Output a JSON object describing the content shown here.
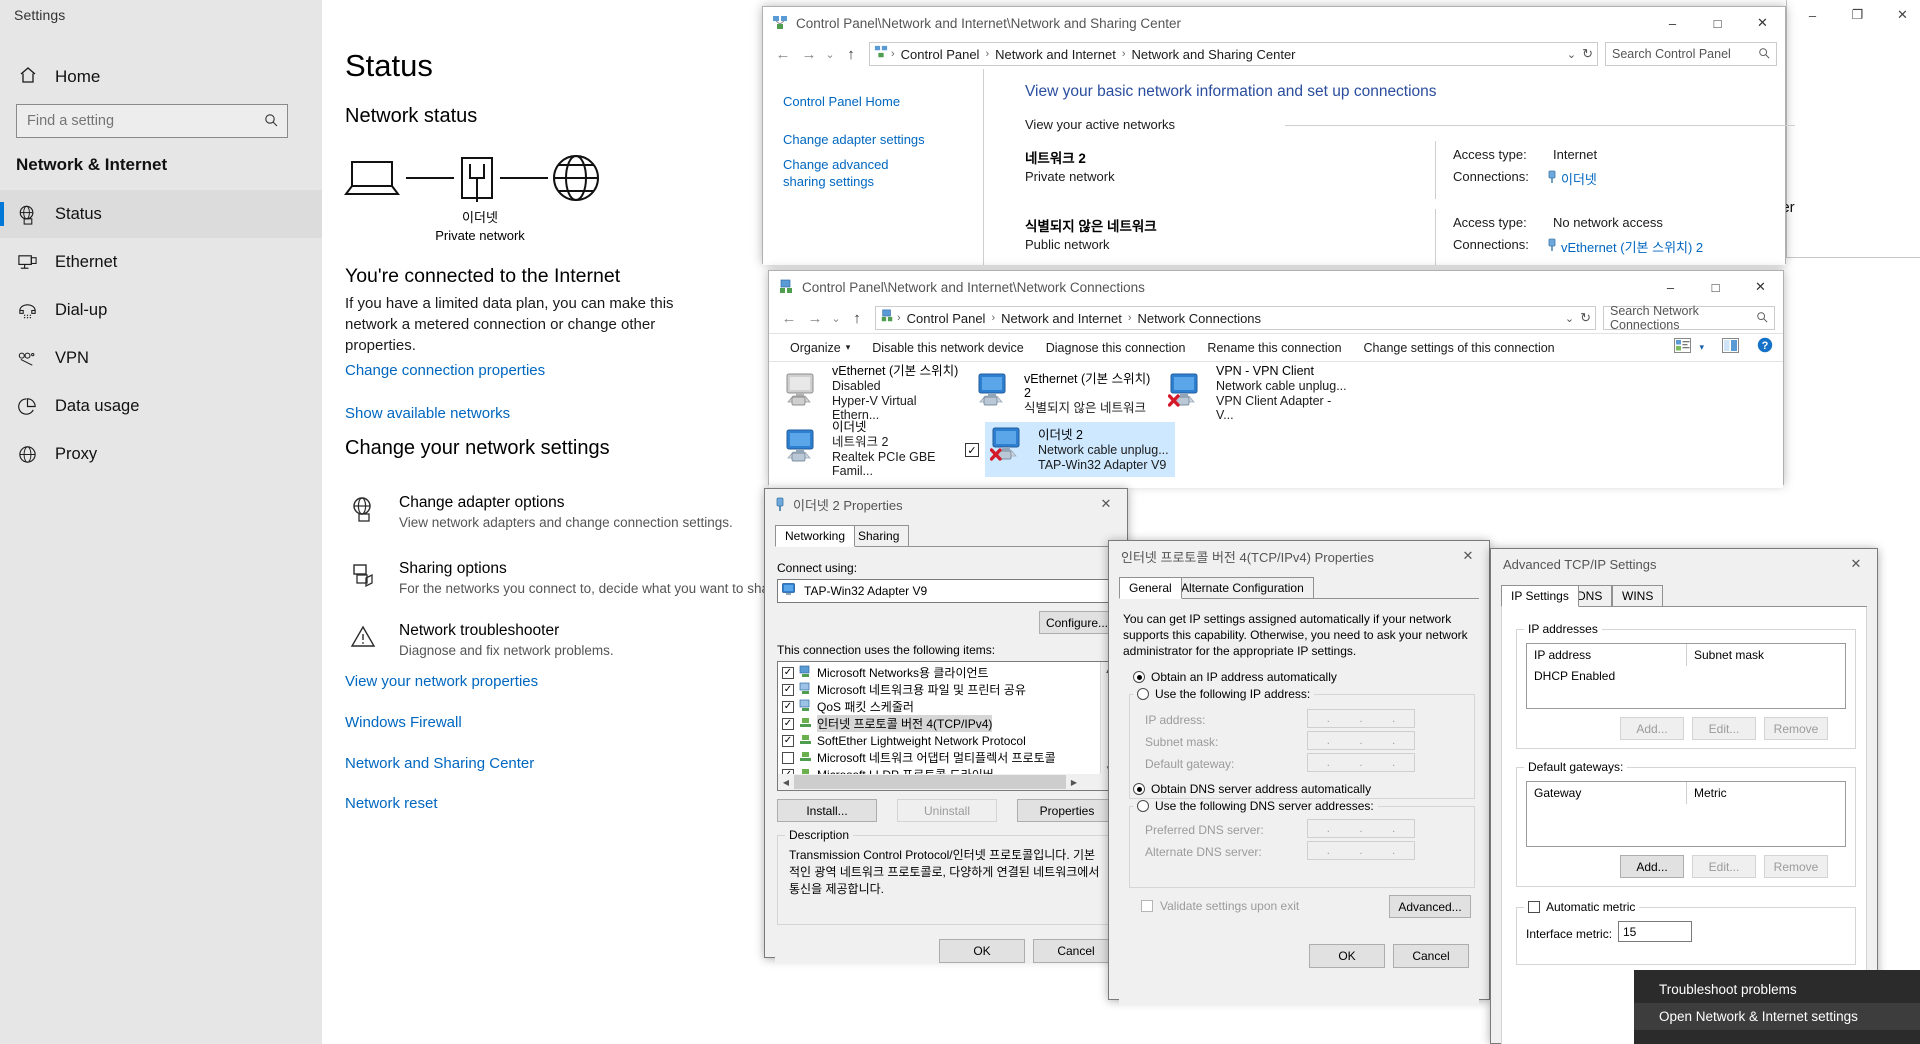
{
  "settings": {
    "window_title": "Settings",
    "home_label": "Home",
    "search": {
      "placeholder": "Find a setting",
      "value": "",
      "icon": "search-icon"
    },
    "category": "Network & Internet",
    "nav_items": [
      {
        "label": "Status",
        "icon": "globe-monitor-icon",
        "selected": true
      },
      {
        "label": "Ethernet",
        "icon": "ethernet-icon",
        "selected": false
      },
      {
        "label": "Dial-up",
        "icon": "dialup-icon",
        "selected": false
      },
      {
        "label": "VPN",
        "icon": "vpn-icon",
        "selected": false
      },
      {
        "label": "Data usage",
        "icon": "pie-chart-icon",
        "selected": false
      },
      {
        "label": "Proxy",
        "icon": "globe-icon",
        "selected": false
      }
    ],
    "page_title": "Status",
    "network_status_heading": "Network status",
    "diagram": {
      "network_name": "이더넷",
      "network_type": "Private network"
    },
    "connected_heading": "You're connected to the Internet",
    "connected_desc": "If you have a limited data plan, you can make this network a metered connection or change other properties.",
    "link_change_connection": "Change connection properties",
    "link_show_networks": "Show available networks",
    "change_settings_heading": "Change your network settings",
    "options": [
      {
        "icon": "globe-monitor-icon",
        "title": "Change adapter options",
        "desc": "View network adapters and change connection settings."
      },
      {
        "icon": "sharing-icon",
        "title": "Sharing options",
        "desc": "For the networks you connect to, decide what you want to share."
      },
      {
        "icon": "warning-triangle-icon",
        "title": "Network troubleshooter",
        "desc": "Diagnose and fix network problems."
      }
    ],
    "bottom_links": [
      "View your network properties",
      "Windows Firewall",
      "Network and Sharing Center",
      "Network reset"
    ]
  },
  "background_window": {
    "fragment_text": "tter",
    "caps": {
      "minimize": "–",
      "maximize": "❐",
      "close": "✕"
    }
  },
  "nsc_window": {
    "title": "Control Panel\\Network and Internet\\Network and Sharing Center",
    "title_icon": "network-sharing-icon",
    "caps": {
      "minimize": "–",
      "maximize": "□",
      "close": "✕"
    },
    "nav": {
      "back": "←",
      "forward": "→",
      "recent": "⌄",
      "up": "↑"
    },
    "breadcrumbs": [
      "Control Panel",
      "Network and Internet",
      "Network and Sharing Center"
    ],
    "addr_dropdown": "⌄",
    "addr_refresh": "↻",
    "search_placeholder": "Search Control Panel",
    "search_icon": "search-icon",
    "left_links": [
      "Control Panel Home",
      "Change adapter settings",
      "Change advanced sharing settings"
    ],
    "heading": "View your basic network information and set up connections",
    "subheading": "View your active networks",
    "networks": [
      {
        "name": "네트워크 2",
        "type": "Private network",
        "access_label": "Access type:",
        "access_value": "Internet",
        "connections_label": "Connections:",
        "connection_link": "이더넷",
        "connection_icon": "ethernet-plug-icon"
      },
      {
        "name": "식별되지 않은 네트워크",
        "type": "Public network",
        "access_label": "Access type:",
        "access_value": "No network access",
        "connections_label": "Connections:",
        "connection_link": "vEthernet (기본 스위치) 2",
        "connection_icon": "ethernet-plug-icon"
      }
    ]
  },
  "nc_window": {
    "title": "Control Panel\\Network and Internet\\Network Connections",
    "title_icon": "network-connections-icon",
    "caps": {
      "minimize": "–",
      "maximize": "□",
      "close": "✕"
    },
    "nav": {
      "back": "←",
      "forward": "→",
      "recent": "⌄",
      "up": "↑"
    },
    "breadcrumbs": [
      "Control Panel",
      "Network and Internet",
      "Network Connections"
    ],
    "addr_dropdown": "⌄",
    "addr_refresh": "↻",
    "search_placeholder": "Search Network Connections",
    "search_icon": "search-icon",
    "toolbar": {
      "organize": "Organize",
      "organize_caret": "▾",
      "items": [
        "Disable this network device",
        "Diagnose this connection",
        "Rename this connection",
        "Change settings of this connection"
      ],
      "view_icon": "view-details-icon",
      "view_caret": "▾",
      "pane_icon": "preview-pane-icon",
      "help_icon": "help-icon"
    },
    "adapters": [
      {
        "name": "vEthernet (기본 스위치)",
        "status": "Disabled",
        "device": "Hyper-V Virtual Ethern...",
        "state": "disabled",
        "selected": false,
        "checked": false
      },
      {
        "name": "vEthernet (기본 스위치) 2",
        "status": "식별되지 않은 네트워크",
        "device": "",
        "state": "enabled",
        "selected": false,
        "checked": false
      },
      {
        "name": "VPN - VPN Client",
        "status": "Network cable unplug...",
        "device": "VPN Client Adapter - V...",
        "state": "unplugged",
        "selected": false,
        "checked": false
      },
      {
        "name": "이더넷",
        "status": "네트워크 2",
        "device": "Realtek PCIe GBE Famil...",
        "state": "enabled",
        "selected": false,
        "checked": false
      },
      {
        "name": "이더넷 2",
        "status": "Network cable unplug...",
        "device": "TAP-Win32 Adapter V9",
        "state": "unplugged",
        "selected": true,
        "checked": true
      }
    ]
  },
  "eth2_props": {
    "title": "이더넷 2 Properties",
    "title_icon": "network-adapter-icon",
    "close": "✕",
    "tabs": [
      {
        "label": "Networking",
        "active": true
      },
      {
        "label": "Sharing",
        "active": false
      }
    ],
    "connect_using_label": "Connect using:",
    "adapter_name": "TAP-Win32 Adapter V9",
    "adapter_icon": "monitor-icon",
    "configure_button": "Configure...",
    "items_label": "This connection uses the following items:",
    "items": [
      {
        "label": "Microsoft Networks용 클라이언트",
        "checked": true,
        "icon": "client-icon",
        "selected": false
      },
      {
        "label": "Microsoft 네트워크용 파일 및 프린터 공유",
        "checked": true,
        "icon": "service-icon",
        "selected": false
      },
      {
        "label": "QoS 패킷 스케줄러",
        "checked": true,
        "icon": "service-icon",
        "selected": false
      },
      {
        "label": "인터넷 프로토콜 버전 4(TCP/IPv4)",
        "checked": true,
        "icon": "protocol-icon",
        "selected": true
      },
      {
        "label": "SoftEther Lightweight Network Protocol",
        "checked": true,
        "icon": "protocol-icon",
        "selected": false
      },
      {
        "label": "Microsoft 네트워크 어댑터 멀티플렉서 프로토콜",
        "checked": false,
        "icon": "protocol-icon",
        "selected": false
      },
      {
        "label": "Microsoft LLDP 프로토콜 드라이버",
        "checked": true,
        "icon": "protocol-icon",
        "selected": false
      }
    ],
    "buttons": {
      "install": "Install...",
      "uninstall": "Uninstall",
      "properties": "Properties"
    },
    "description_label": "Description",
    "description_text": "Transmission Control Protocol/인터넷 프로토콜입니다. 기본적인 광역 네트워크 프로토콜로, 다양하게 연결된 네트워크에서 통신을 제공합니다.",
    "ok": "OK",
    "cancel": "Cancel"
  },
  "tcpip_props": {
    "title": "인터넷 프로토콜 버전 4(TCP/IPv4) Properties",
    "close": "✕",
    "tabs": [
      {
        "label": "General",
        "active": true
      },
      {
        "label": "Alternate Configuration",
        "active": false
      }
    ],
    "intro": "You can get IP settings assigned automatically if your network supports this capability. Otherwise, you need to ask your network administrator for the appropriate IP settings.",
    "radio_auto_ip": {
      "label": "Obtain an IP address automatically",
      "selected": true
    },
    "radio_manual_ip": {
      "label": "Use the following IP address:",
      "selected": false
    },
    "fields_ip": [
      {
        "label": "IP address:",
        "value": "",
        "disabled": true
      },
      {
        "label": "Subnet mask:",
        "value": "",
        "disabled": true
      },
      {
        "label": "Default gateway:",
        "value": "",
        "disabled": true
      }
    ],
    "radio_auto_dns": {
      "label": "Obtain DNS server address automatically",
      "selected": true
    },
    "radio_manual_dns": {
      "label": "Use the following DNS server addresses:",
      "selected": false
    },
    "fields_dns": [
      {
        "label": "Preferred DNS server:",
        "value": "",
        "disabled": true
      },
      {
        "label": "Alternate DNS server:",
        "value": "",
        "disabled": true
      }
    ],
    "validate_checkbox": {
      "label": "Validate settings upon exit",
      "checked": false
    },
    "advanced_button": "Advanced...",
    "ok": "OK",
    "cancel": "Cancel"
  },
  "advanced_tcpip": {
    "title": "Advanced TCP/IP Settings",
    "close": "✕",
    "tabs": [
      {
        "label": "IP Settings",
        "active": true
      },
      {
        "label": "DNS",
        "active": false
      },
      {
        "label": "WINS",
        "active": false
      }
    ],
    "ip_group_label": "IP addresses",
    "ip_columns": [
      "IP address",
      "Subnet mask"
    ],
    "ip_rows": [
      [
        "DHCP Enabled",
        ""
      ]
    ],
    "ip_buttons": [
      {
        "label": "Add...",
        "disabled": true
      },
      {
        "label": "Edit...",
        "disabled": true
      },
      {
        "label": "Remove",
        "disabled": true
      }
    ],
    "gw_group_label": "Default gateways:",
    "gw_columns": [
      "Gateway",
      "Metric"
    ],
    "gw_rows": [],
    "gw_buttons": [
      {
        "label": "Add...",
        "disabled": false
      },
      {
        "label": "Edit...",
        "disabled": true
      },
      {
        "label": "Remove",
        "disabled": true
      }
    ],
    "auto_metric_checkbox": {
      "label": "Automatic metric",
      "checked": false
    },
    "interface_metric_label": "Interface metric:",
    "interface_metric_value": "15"
  },
  "context_menu": {
    "items": [
      {
        "label": "Troubleshoot problems",
        "hovered": false
      },
      {
        "label": "Open Network & Internet settings",
        "hovered": true
      }
    ]
  }
}
